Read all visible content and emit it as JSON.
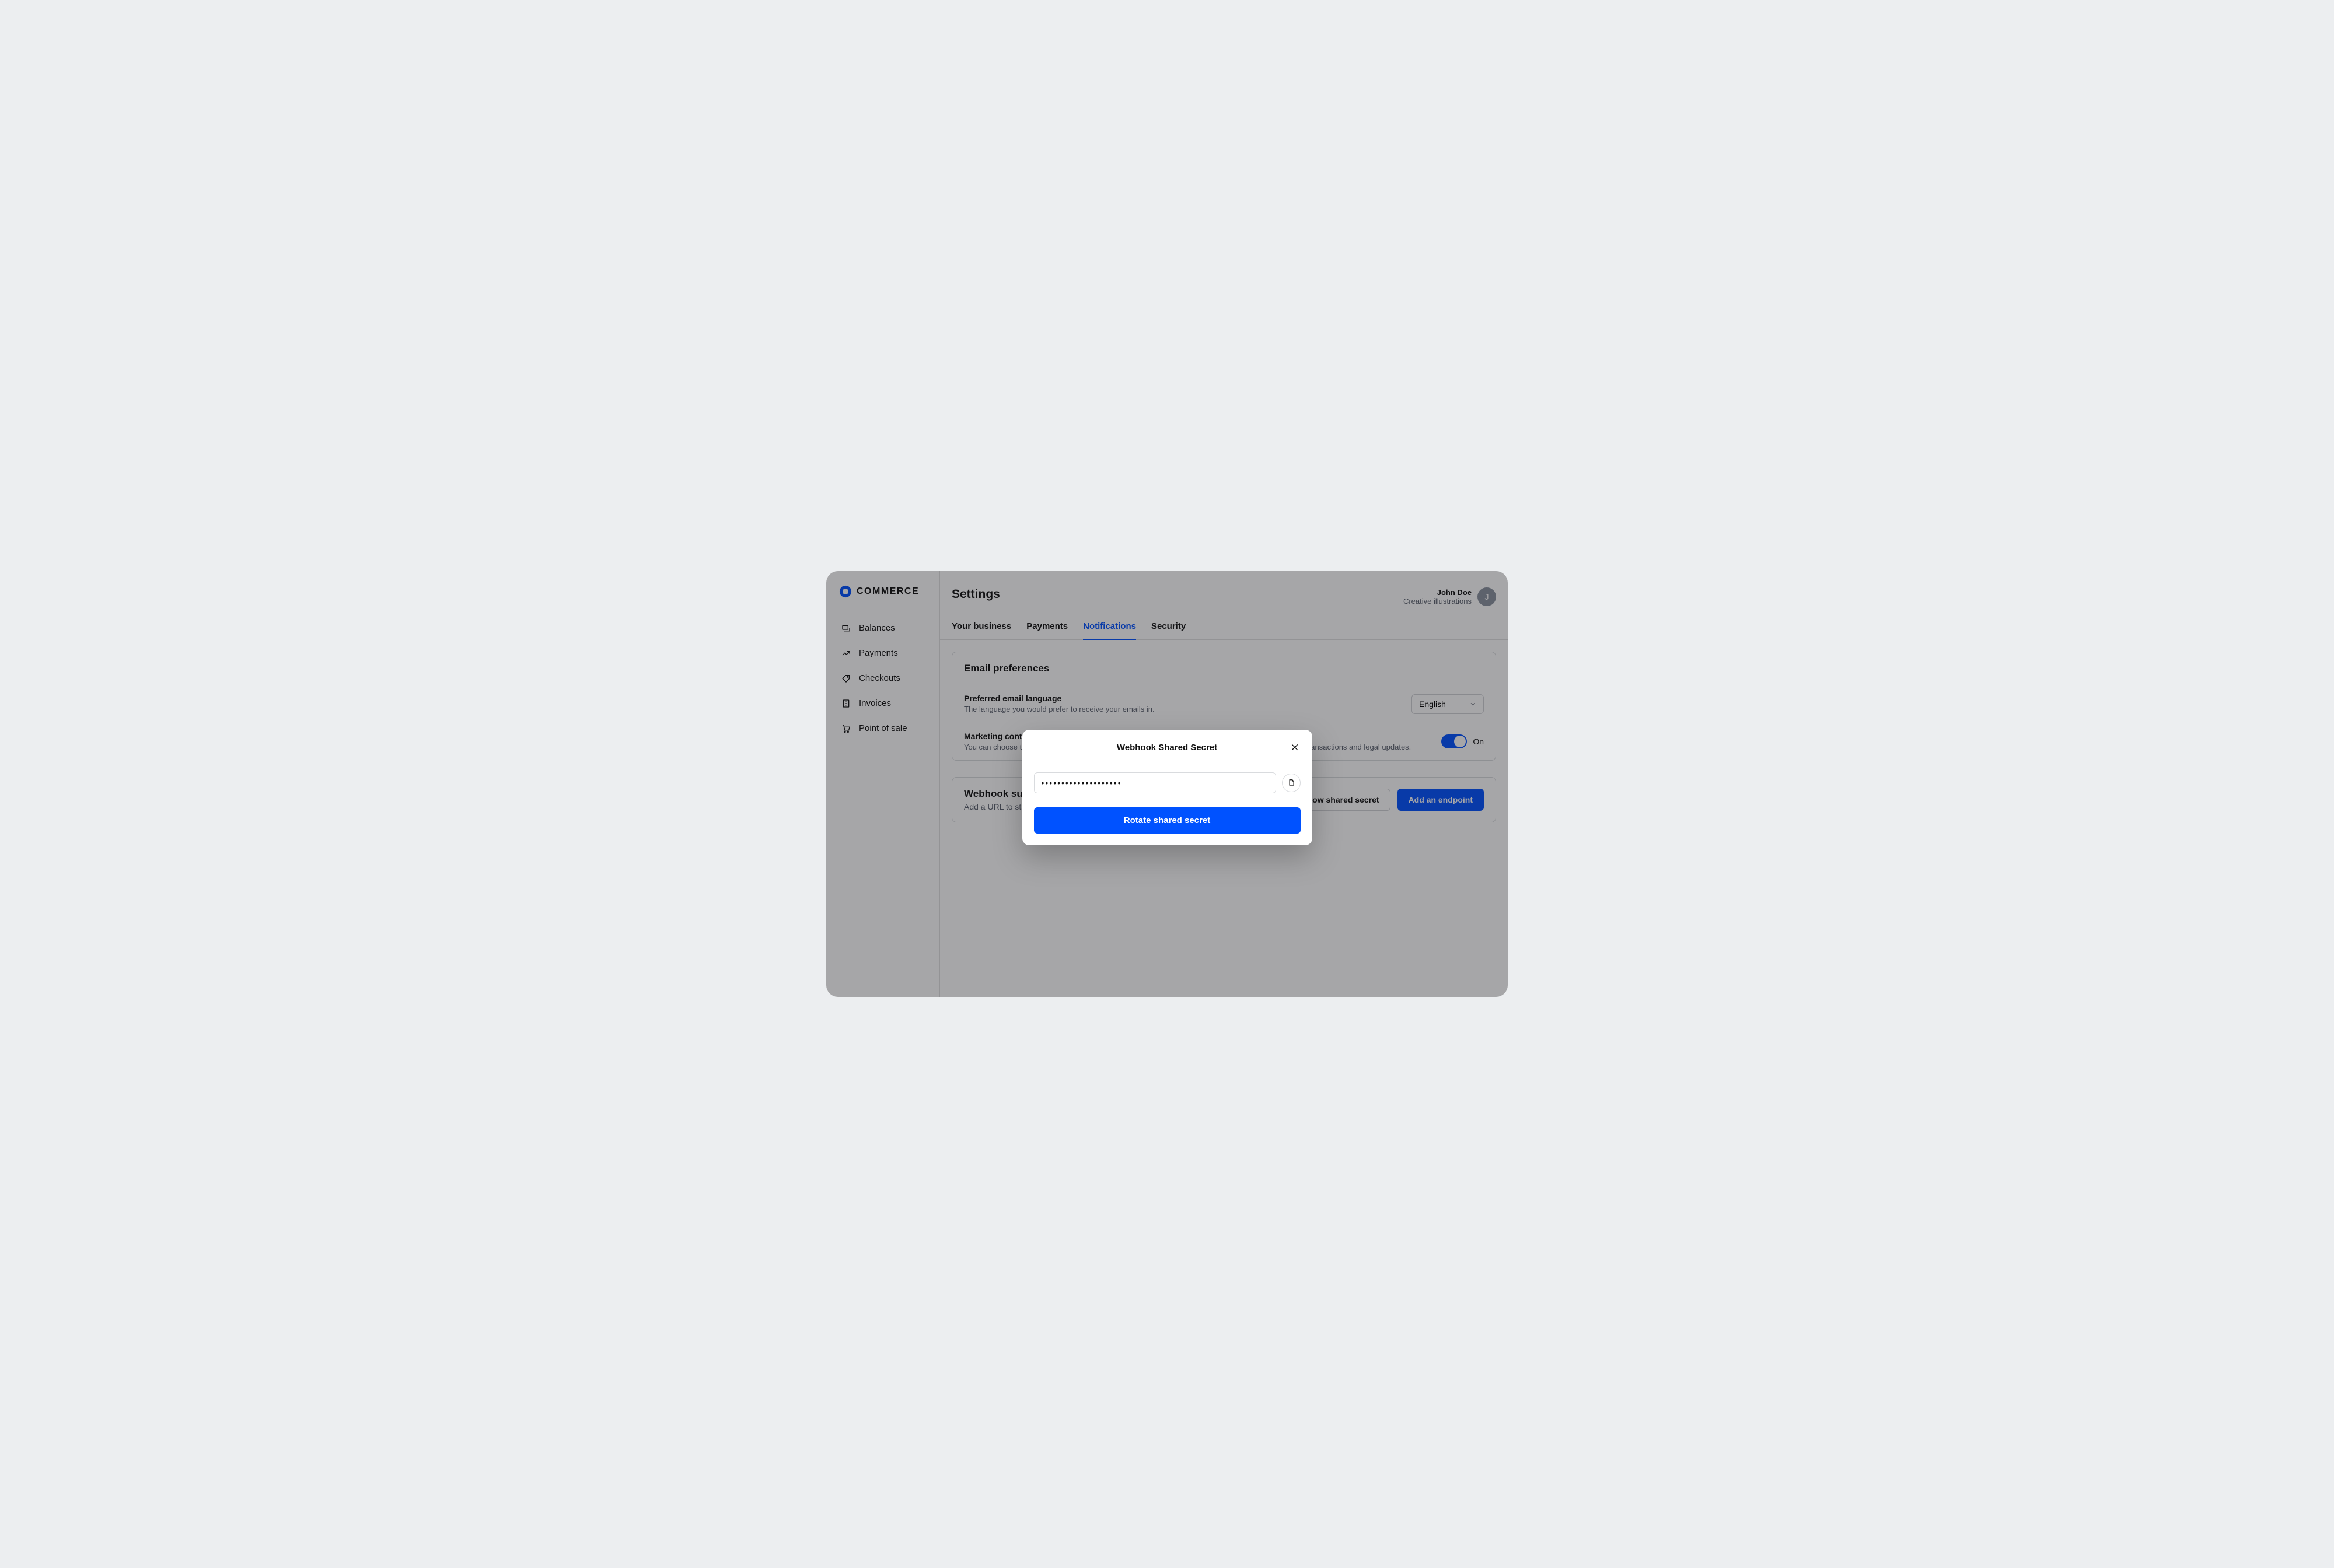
{
  "brand": {
    "name": "COMMERCE"
  },
  "sidebar": {
    "items": [
      {
        "label": "Balances"
      },
      {
        "label": "Payments"
      },
      {
        "label": "Checkouts"
      },
      {
        "label": "Invoices"
      },
      {
        "label": "Point of sale"
      }
    ]
  },
  "header": {
    "title": "Settings",
    "user_name": "John Doe",
    "user_org": "Creative illustrations",
    "avatar_initial": "J"
  },
  "tabs": [
    {
      "label": "Your business"
    },
    {
      "label": "Payments"
    },
    {
      "label": "Notifications",
      "active": true
    },
    {
      "label": "Security"
    }
  ],
  "email_prefs": {
    "section_title": "Email preferences",
    "language_label": "Preferred email language",
    "language_desc": "The language you would prefer to receive your emails in.",
    "language_value": "English",
    "marketing_label": "Marketing content",
    "marketing_desc": "You can choose to opt out of marketing emails. Note: you'll still receive emails about account security, transactions and legal updates.",
    "marketing_toggle_label": "On"
  },
  "webhook": {
    "title": "Webhook subscriptions",
    "desc": "Add a URL to start receiving events for this account, or read the docs.",
    "show_secret_label": "Show shared secret",
    "add_endpoint_label": "Add an endpoint"
  },
  "modal": {
    "title": "Webhook Shared Secret",
    "secret_masked": "••••••••••••••••••••",
    "rotate_label": "Rotate shared secret"
  }
}
